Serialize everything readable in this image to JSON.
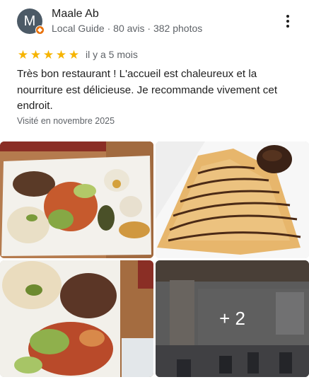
{
  "reviewer": {
    "avatar_letter": "M",
    "name": "Maale Ab",
    "meta": "Local Guide · 80 avis · 382 photos"
  },
  "review": {
    "stars": 5,
    "star_glyph": "★",
    "time": "il y a 5 mois",
    "text": "Très bon restaurant ! L'accueil est chaleureux et la nourriture est délicieuse. Je recommande vivement cet endroit.",
    "visited": "Visité en novembre 2025"
  },
  "photos": {
    "more_count_label": "+ 2"
  },
  "colors": {
    "star": "#f6b400",
    "avatar_bg": "#4c5a66",
    "local_guide_badge": "#e8710a"
  },
  "icons": [
    "local-guide-badge-icon",
    "more-vert-icon",
    "star-icon"
  ]
}
